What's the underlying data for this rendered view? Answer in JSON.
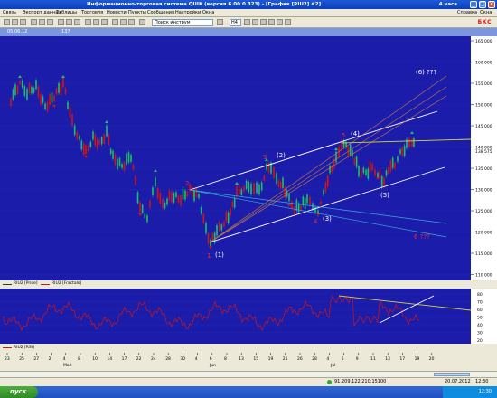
{
  "window": {
    "title": "Информационно-торговая система QUIK (версия 6.00.0.323) - [График [RIU2] #2]",
    "top_right_label": "4 часа"
  },
  "menu": {
    "items": [
      "Связь",
      "Экспорт данных",
      "Таблицы",
      "Торговля",
      "Новости",
      "Пункты",
      "Сообщения",
      "Настройки",
      "Окна"
    ],
    "right_items": [
      "Справка",
      "Окна"
    ]
  },
  "toolbar": {
    "search_placeholder": "Поиск инструм",
    "interval": "H4",
    "brand": "БКС"
  },
  "chart_header": {
    "date_field": "05.06.12 08:00",
    "value_field": "137 067.33"
  },
  "price_scale": {
    "labels": [
      "165 000",
      "160 000",
      "155 000",
      "150 000",
      "145 000",
      "140 000",
      "135 000",
      "130 000",
      "125 000",
      "120 000",
      "115 000",
      "110 000"
    ],
    "current": "138 575"
  },
  "osc_scale": {
    "labels": [
      "80",
      "70",
      "60",
      "50",
      "40",
      "30",
      "20"
    ]
  },
  "annotations": {
    "wave1": "(1)",
    "wave2": "(2)",
    "wave3": "(3)",
    "wave4": "(4)",
    "wave5": "(5)",
    "wave6": "(6) ???",
    "red1": "1",
    "red2": "2",
    "red3": "3",
    "red4": "4",
    "red5": "5",
    "red6": "6 ???"
  },
  "legend": {
    "main_a": "RIU2 [Price]",
    "main_b": "RIU2 [Fractals]",
    "osc": "RIU2 [RSI]"
  },
  "xaxis": {
    "days": [
      "23",
      "25",
      "27",
      "2",
      "4",
      "8",
      "10",
      "14",
      "17",
      "22",
      "24",
      "28",
      "30",
      "4",
      "6",
      "8",
      "13",
      "15",
      "19",
      "21",
      "26",
      "28",
      "4",
      "6",
      "9",
      "11",
      "13",
      "17",
      "19",
      "20"
    ],
    "months": [
      "Май",
      "Jun",
      "Jul"
    ]
  },
  "status": {
    "connection": "91.209.122.210:15100",
    "date": "20.07.2012",
    "time": "12:30"
  },
  "taskbar": {
    "start": "пуск",
    "clock": "12:30"
  },
  "colors": {
    "background": "#1c1caa",
    "candle_up": "#1fbf6a",
    "candle_down": "#d01515",
    "trend_white": "#ffffff",
    "trend_yellow": "#d6d63a",
    "trend_cyan": "#39a9d8",
    "trend_orange": "#c87a46",
    "wave_red": "#e03030"
  }
}
